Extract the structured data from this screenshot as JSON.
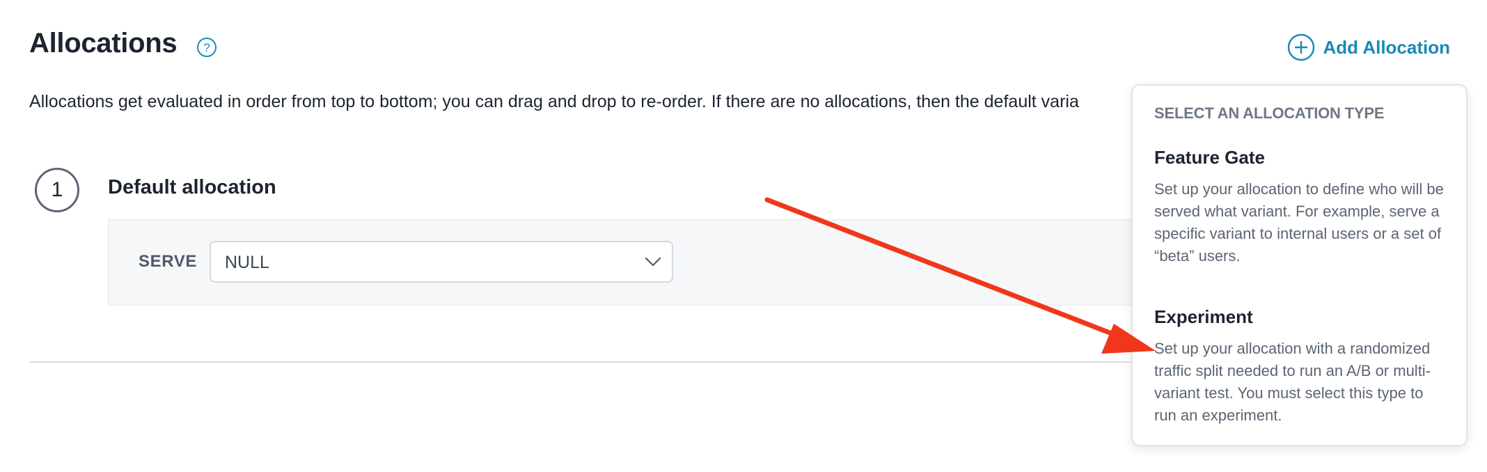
{
  "header": {
    "title": "Allocations",
    "help_icon": "question-circle-icon",
    "add_button_label": "Add Allocation",
    "add_icon": "plus-circle-icon",
    "accent_color": "#1a8ab6"
  },
  "description": "Allocations get evaluated in order from top to bottom; you can drag and drop to re-order. If there are no allocations, then the default varia",
  "allocation": {
    "number": "1",
    "title": "Default allocation",
    "serve_label": "SERVE",
    "serve_value": "NULL",
    "chevron_icon": "chevron-down-icon"
  },
  "dropdown": {
    "header": "SELECT AN ALLOCATION TYPE",
    "options": [
      {
        "name": "Feature Gate",
        "description": "Set up your allocation to define who will be served what variant. For example, serve a specific variant to internal users or a set of “beta” users."
      },
      {
        "name": "Experiment",
        "description": "Set up your allocation with a randomized traffic split needed to run an A/B or multi-variant test. You must select this type to run an experiment."
      }
    ]
  },
  "annotation": {
    "arrow_color": "#f0371b"
  }
}
